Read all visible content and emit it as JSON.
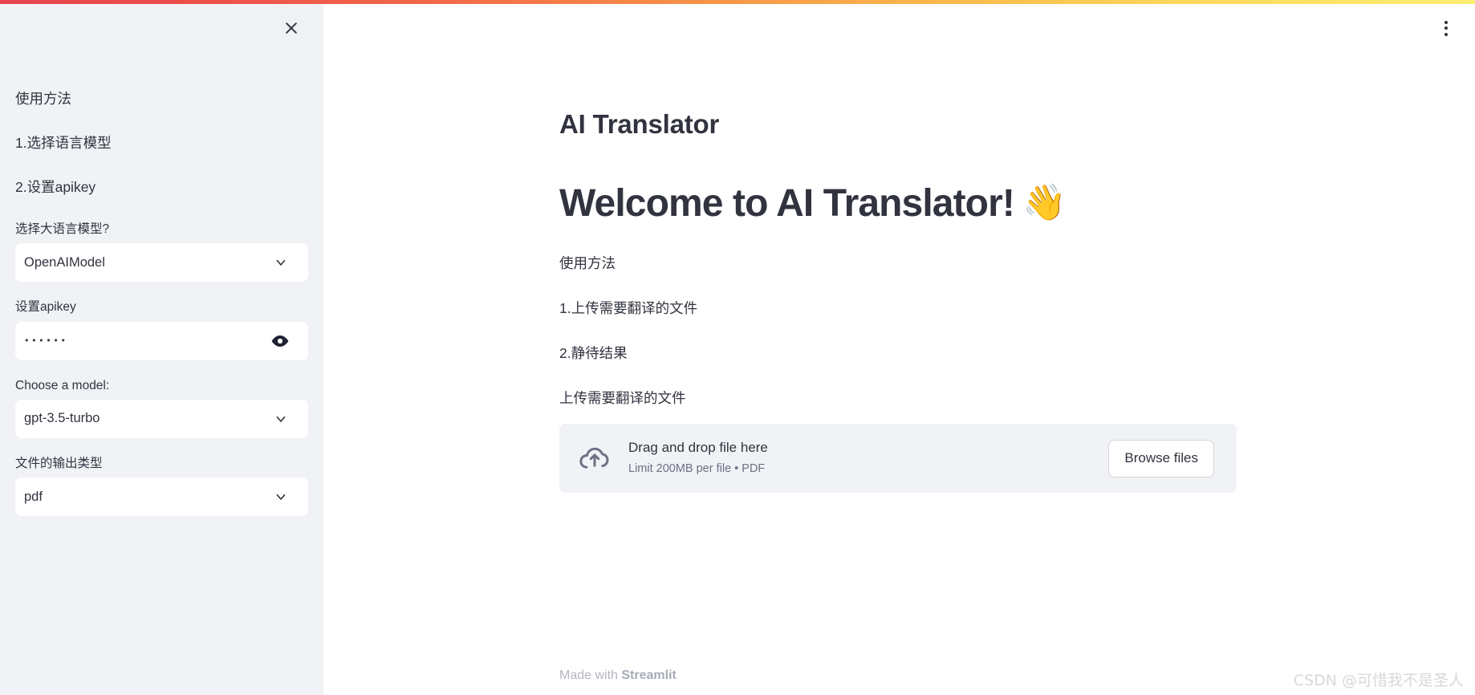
{
  "theme": {
    "sidebar_bg": "#f0f2f6",
    "main_bg": "#ffffff",
    "text": "#31333f",
    "muted": "#6c7183",
    "gradient_start": "#e8434f",
    "gradient_end": "#fcee73"
  },
  "sidebar": {
    "close_icon": "close-icon",
    "intro": [
      "使用方法",
      "1.选择语言模型",
      "2.设置apikey"
    ],
    "fields": [
      {
        "label": "选择大语言模型?",
        "type": "select",
        "value": "OpenAIModel",
        "icon": "chevron-down-icon"
      },
      {
        "label": "设置apikey",
        "type": "password",
        "value": "••••••",
        "icon": "eye-icon"
      },
      {
        "label": "Choose a model:",
        "type": "select",
        "value": "gpt-3.5-turbo",
        "icon": "chevron-down-icon"
      },
      {
        "label": "文件的输出类型",
        "type": "select",
        "value": "pdf",
        "icon": "chevron-down-icon"
      }
    ]
  },
  "main": {
    "menu_icon": "kebab-menu-icon",
    "app_title": "AI Translator",
    "welcome_heading": "Welcome to AI Translator!",
    "welcome_emoji": "👋",
    "paragraphs": [
      "使用方法",
      "1.上传需要翻译的文件",
      "2.静待结果"
    ],
    "uploader_label": "上传需要翻译的文件",
    "uploader": {
      "icon": "cloud-upload-icon",
      "drop_text": "Drag and drop file here",
      "limit_text": "Limit 200MB per file • PDF",
      "browse_label": "Browse files"
    },
    "footer_prefix": "Made with ",
    "footer_brand": "Streamlit",
    "watermark": "CSDN @可惜我不是圣人"
  }
}
